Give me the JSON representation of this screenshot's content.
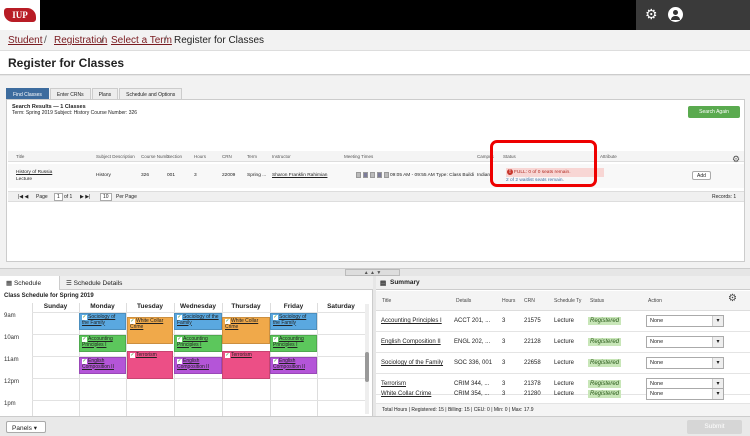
{
  "header": {
    "logo_text": "IUP"
  },
  "breadcrumb": [
    "Student",
    "Registration",
    "Select a Term",
    "Register for Classes"
  ],
  "page_title": "Register for Classes",
  "tabs": [
    "Find Classes",
    "Enter CRNs",
    "Plans",
    "Schedule and Options"
  ],
  "search_results": {
    "title": "Search Results — 1 Classes",
    "subtitle": "Term: Spring 2019   Subject: History   Course Number: 326",
    "search_again": "Search Again",
    "columns": [
      "Title",
      "Subject Description",
      "Course Numb",
      "Section",
      "Hours",
      "CRN",
      "Term",
      "Instructor",
      "Meeting Times",
      "Campus",
      "Status",
      "Attribute"
    ],
    "row": {
      "title": "History of Russia",
      "type": "Lecture",
      "subject": "History",
      "course": "326",
      "section": "001",
      "hours": "3",
      "crn": "22009",
      "term": "Spring ...",
      "instructor": "Sharon Franklin Rahimian",
      "meeting": "09:05 AM - 09:55 AM Type: Class Buildi",
      "campus": "Indian",
      "status_full": "FULL: 0 of 0 seats remain.",
      "status_wait": "2 of 2 waitlist seats remain.",
      "add": "Add"
    },
    "pager": {
      "page_label": "Page",
      "page": "1",
      "of": "of 1",
      "per_page": "10",
      "per_page_label": "Per Page",
      "records": "Records: 1"
    }
  },
  "schedule": {
    "tab_schedule": "Schedule",
    "tab_details": "Schedule Details",
    "title": "Class Schedule for Spring 2019",
    "days": [
      "Sunday",
      "Monday",
      "Tuesday",
      "Wednesday",
      "Thursday",
      "Friday",
      "Saturday"
    ],
    "hours": [
      "9am",
      "10am",
      "11am",
      "12pm",
      "1pm"
    ],
    "events": [
      {
        "label": "Sociology of the Family",
        "color": "#5aa8e0"
      },
      {
        "label": "White Collar Crime",
        "color": "#f0a94a"
      },
      {
        "label": "Sociology of the Family",
        "color": "#5aa8e0"
      },
      {
        "label": "White Collar Crime",
        "color": "#f0a94a"
      },
      {
        "label": "Sociology of the Family",
        "color": "#5aa8e0"
      },
      {
        "label": "Accounting Principles I",
        "color": "#5cc75c"
      },
      {
        "label": "Accounting Principles I",
        "color": "#5cc75c"
      },
      {
        "label": "Accounting Principles I",
        "color": "#5cc75c"
      },
      {
        "label": "English Composition II",
        "color": "#b455d8"
      },
      {
        "label": "Terrorism",
        "color": "#ec4f86"
      },
      {
        "label": "English Composition II",
        "color": "#b455d8"
      },
      {
        "label": "Terrorism",
        "color": "#ec4f86"
      },
      {
        "label": "English Composition II",
        "color": "#b455d8"
      }
    ]
  },
  "summary": {
    "title": "Summary",
    "columns": [
      "Title",
      "Details",
      "Hours",
      "CRN",
      "Schedule Ty",
      "Status",
      "Action"
    ],
    "rows": [
      {
        "title": "Accounting Principles I",
        "details": "ACCT 201, ...",
        "hours": "3",
        "crn": "21575",
        "type": "Lecture",
        "status": "Registered",
        "action": "None"
      },
      {
        "title": "English Composition II",
        "details": "ENGL 202, ...",
        "hours": "3",
        "crn": "22128",
        "type": "Lecture",
        "status": "Registered",
        "action": "None"
      },
      {
        "title": "Sociology of the Family",
        "details": "SOC 336, 001",
        "hours": "3",
        "crn": "22658",
        "type": "Lecture",
        "status": "Registered",
        "action": "None"
      },
      {
        "title": "Terrorism",
        "details": "CRIM 344, ...",
        "hours": "3",
        "crn": "21378",
        "type": "Lecture",
        "status": "Registered",
        "action": "None"
      },
      {
        "title": "White Collar Crime",
        "details": "CRIM 354, ...",
        "hours": "3",
        "crn": "21280",
        "type": "Lecture",
        "status": "Registered",
        "action": "None"
      }
    ],
    "total": "Total Hours | Registered: 15 | Billing: 15 | CEU: 0 | Min: 0 | Max: 17.9"
  },
  "footer": {
    "panels": "Panels",
    "submit": "Submit"
  }
}
